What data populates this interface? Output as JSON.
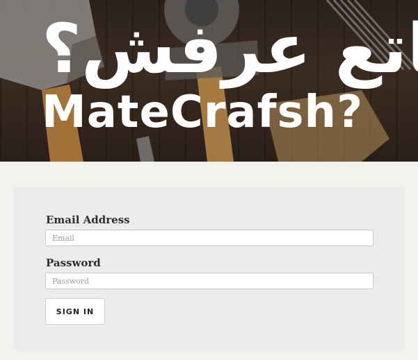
{
  "header": {
    "logo_arabic": "ماتع عرفش؟",
    "logo_latin": "MateCrafsh?"
  },
  "login_form": {
    "email_label": "Email Address",
    "email_placeholder": "Email",
    "email_value": "",
    "password_label": "Password",
    "password_placeholder": "Password",
    "password_value": "",
    "submit_label": "SIGN IN"
  },
  "colors": {
    "page_background": "#f3f2ed",
    "panel_background": "#ececec",
    "logo": "#ffffff"
  }
}
